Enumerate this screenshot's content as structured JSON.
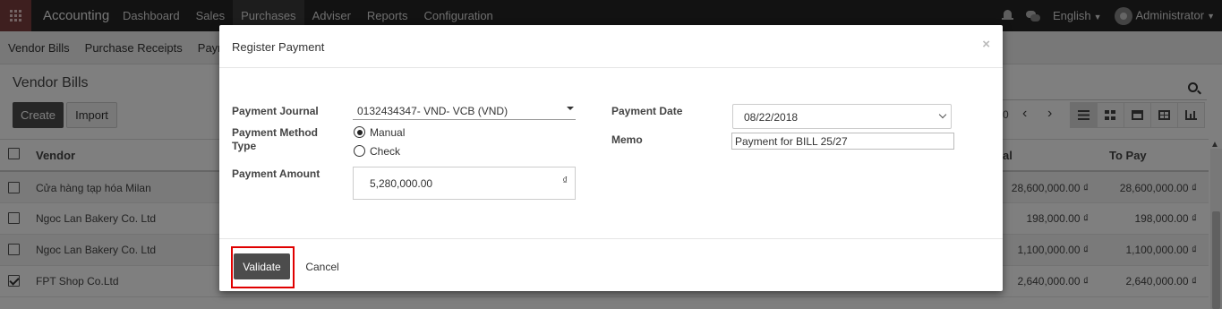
{
  "topbar": {
    "app_name": "Accounting",
    "menu": [
      "Dashboard",
      "Sales",
      "Purchases",
      "Adviser",
      "Reports",
      "Configuration"
    ],
    "language": "English",
    "user": "Administrator"
  },
  "subnav": [
    "Vendor Bills",
    "Purchase Receipts",
    "Paym"
  ],
  "control_panel": {
    "title": "Vendor Bills",
    "create_label": "Create",
    "import_label": "Import",
    "pager_fragment": "0"
  },
  "list": {
    "headers": {
      "vendor": "Vendor",
      "total": "al",
      "to_pay": "To Pay"
    },
    "rows": [
      {
        "vendor": "Cửa hàng tạp hóa Milan",
        "total": "28,600,000.00 ₫",
        "to_pay": "28,600,000.00 ₫",
        "checked": false
      },
      {
        "vendor": "Ngoc Lan Bakery Co. Ltd",
        "total": "198,000.00 ₫",
        "to_pay": "198,000.00 ₫",
        "checked": false
      },
      {
        "vendor": "Ngoc Lan Bakery Co. Ltd",
        "total": "1,100,000.00 ₫",
        "to_pay": "1,100,000.00 ₫",
        "checked": false
      },
      {
        "vendor": "FPT Shop Co.Ltd",
        "total": "2,640,000.00 ₫",
        "to_pay": "2,640,000.00 ₫",
        "checked": true
      }
    ]
  },
  "modal": {
    "title": "Register Payment",
    "close": "×",
    "payment_journal_label": "Payment Journal",
    "payment_journal_value": "0132434347- VND- VCB (VND)",
    "payment_method_label": "Payment Method Type",
    "method_manual": "Manual",
    "method_check": "Check",
    "payment_amount_label": "Payment Amount",
    "payment_amount_value": "5,280,000.00",
    "currency_symbol": "₫",
    "payment_date_label": "Payment Date",
    "payment_date_value": "08/22/2018",
    "memo_label": "Memo",
    "memo_value": "Payment for BILL 25/27",
    "validate_label": "Validate",
    "cancel_label": "Cancel"
  },
  "colors": {
    "topbar": "#242424",
    "apps_button": "#7c3e3e",
    "primary_button": "#4c4c4c",
    "highlight": "#e00000"
  }
}
